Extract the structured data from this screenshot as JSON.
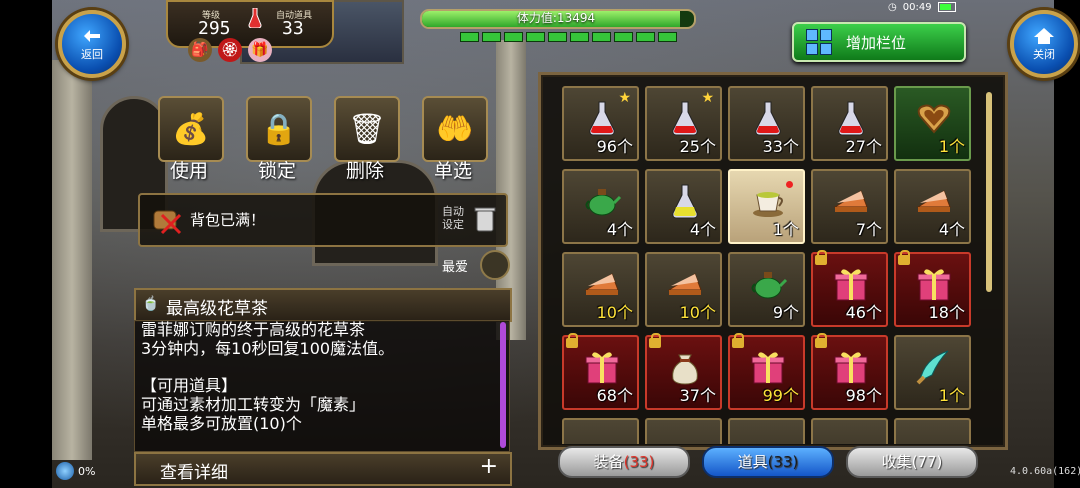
{
  "header": {
    "back_label": "返回",
    "close_label": "关闭",
    "level_label": "等级",
    "level_value": "295",
    "auto_label": "自动道具",
    "auto_value": "33",
    "stamina_text": "体力值:13494",
    "stamina_ratio": 0.95,
    "add_slot_label": "增加栏位",
    "time": "00:49"
  },
  "actions": [
    {
      "label": "使用",
      "icon": "bag-icon"
    },
    {
      "label": "锁定",
      "icon": "lock-icon"
    },
    {
      "label": "删除",
      "icon": "trash-icon"
    },
    {
      "label": "单选",
      "icon": "hand-icon"
    }
  ],
  "bag_notice": {
    "text": "背包已满！",
    "auto_line1": "自动",
    "auto_line2": "设定"
  },
  "favorite_label": "最爱",
  "detail": {
    "title": "最高级花草茶",
    "lines": [
      "雷菲娜订购的终于高级的花草茶",
      "3分钟内，每10秒回复100魔法值。",
      "",
      "【可用道具】",
      "可通过素材加工转变为「魔素」",
      "单格最多可放置(10)个"
    ],
    "more_label": "查看详细",
    "plus": "+"
  },
  "net_label": "0%",
  "inventory": [
    {
      "icon": "red-potion-icon",
      "count": "96个",
      "style": "",
      "star": true
    },
    {
      "icon": "red-potion-icon",
      "count": "25个",
      "style": "",
      "star": true
    },
    {
      "icon": "red-potion-icon",
      "count": "33个",
      "style": ""
    },
    {
      "icon": "red-potion-icon",
      "count": "27个",
      "style": ""
    },
    {
      "icon": "heart-cookie-icon",
      "count": "1个",
      "style": "green",
      "yellow": true
    },
    {
      "icon": "green-teapot-icon",
      "count": "4个",
      "style": ""
    },
    {
      "icon": "yellow-potion-icon",
      "count": "4个",
      "style": ""
    },
    {
      "icon": "tea-cup-icon",
      "count": "1个",
      "style": "sel",
      "dot": true
    },
    {
      "icon": "pie-icon",
      "count": "7个",
      "style": ""
    },
    {
      "icon": "pie-icon",
      "count": "4个",
      "style": ""
    },
    {
      "icon": "pie-icon",
      "count": "10个",
      "style": "",
      "yellow": true
    },
    {
      "icon": "pie-icon",
      "count": "10个",
      "style": "",
      "yellow": true
    },
    {
      "icon": "green-teapot-icon",
      "count": "9个",
      "style": ""
    },
    {
      "icon": "gift-box-icon",
      "count": "46个",
      "style": "red",
      "lock": true
    },
    {
      "icon": "gift-box-icon",
      "count": "18个",
      "style": "red",
      "lock": true
    },
    {
      "icon": "gift-box-icon",
      "count": "68个",
      "style": "red",
      "lock": true
    },
    {
      "icon": "money-bag-icon",
      "count": "37个",
      "style": "red",
      "lock": true
    },
    {
      "icon": "gift-box-icon",
      "count": "99个",
      "style": "red",
      "lock": true,
      "yellow": true
    },
    {
      "icon": "gift-box-icon",
      "count": "98个",
      "style": "red",
      "lock": true
    },
    {
      "icon": "blade-icon",
      "count": "1个",
      "style": "",
      "yellow": true
    }
  ],
  "tabs": [
    {
      "label": "装备",
      "count": "(33)",
      "active": false
    },
    {
      "label": "道具",
      "count": "(33)",
      "active": true
    },
    {
      "label": "收集",
      "count": "(77)",
      "active": false
    }
  ],
  "version": "4.0.60a(162)"
}
